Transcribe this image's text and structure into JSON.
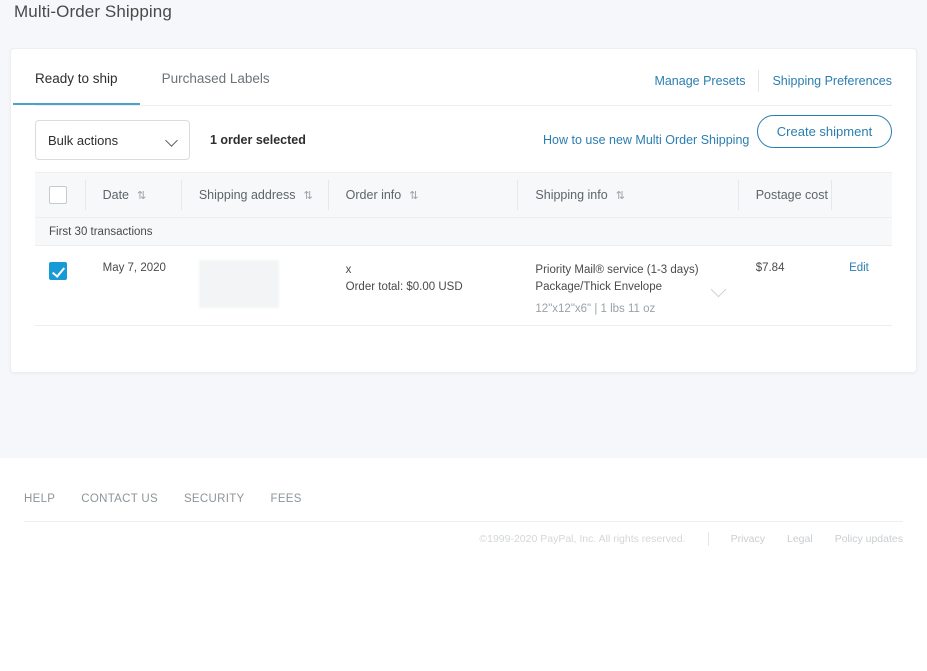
{
  "page": {
    "title": "Multi-Order Shipping"
  },
  "tabs": [
    {
      "label": "Ready to ship",
      "active": true
    },
    {
      "label": "Purchased Labels",
      "active": false
    }
  ],
  "header_links": [
    {
      "label": "Manage Presets"
    },
    {
      "label": "Shipping Preferences"
    }
  ],
  "action_bar": {
    "bulk_actions_label": "Bulk actions",
    "selected_count": "1 order selected",
    "how_to_link": "How to use new Multi Order Shipping",
    "create_button": "Create shipment"
  },
  "table": {
    "columns": [
      {
        "label": "Date",
        "sortable": true
      },
      {
        "label": "Shipping address",
        "sortable": true
      },
      {
        "label": "Order info",
        "sortable": true
      },
      {
        "label": "Shipping info",
        "sortable": true
      },
      {
        "label": "Postage cost",
        "sortable": false
      }
    ],
    "sort_icon": "⇅",
    "group_label": "First 30 transactions",
    "rows": [
      {
        "selected": true,
        "date": "May 7, 2020",
        "shipping_address": "",
        "order_line1": "x",
        "order_total": "Order total: $0.00 USD",
        "ship_service": "Priority Mail® service (1-3 days)",
        "ship_package": "Package/Thick Envelope",
        "ship_dims": "12\"x12\"x6\" | 1 lbs 11 oz",
        "postage_cost": "$7.84",
        "action_label": "Edit"
      }
    ]
  },
  "footer": {
    "links": [
      "HELP",
      "CONTACT US",
      "SECURITY",
      "FEES"
    ],
    "copyright": "©1999-2020 PayPal, Inc. All rights reserved.",
    "legal_links": [
      "Privacy",
      "Legal",
      "Policy updates"
    ]
  },
  "colors": {
    "accent": "#2b7eb0",
    "tab_underline": "#4ba3c7",
    "checkbox": "#179bd7",
    "page_bg": "#f5f7fa"
  }
}
